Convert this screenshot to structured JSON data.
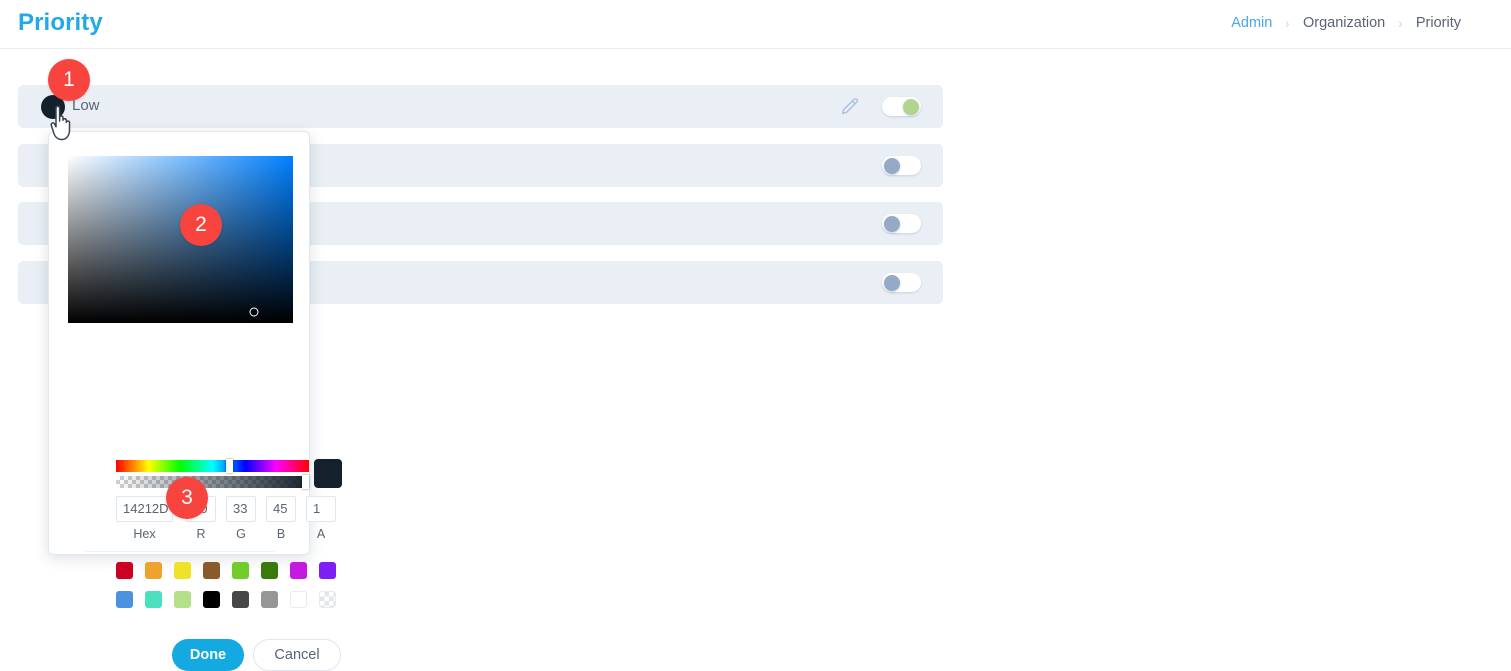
{
  "header": {
    "title": "Priority",
    "breadcrumb": [
      {
        "label": "Admin",
        "is_link": true
      },
      {
        "label": "Organization",
        "is_link": false
      },
      {
        "label": "Priority",
        "is_link": false
      }
    ],
    "separator": "›",
    "title_color": "#23a8e8"
  },
  "priority_rows": [
    {
      "label": "Low",
      "color": "#14212d",
      "toggle_state": "on",
      "has_edit_icon": true
    },
    {
      "label": "",
      "color": "",
      "toggle_state": "off",
      "has_edit_icon": false
    },
    {
      "label": "",
      "color": "",
      "toggle_state": "off",
      "has_edit_icon": false
    },
    {
      "label": "",
      "color": "",
      "toggle_state": "off",
      "has_edit_icon": false
    }
  ],
  "step_badges": [
    {
      "number": "1"
    },
    {
      "number": "2"
    },
    {
      "number": "3"
    }
  ],
  "color_picker": {
    "selected_color": "#14212d",
    "fields": {
      "hex": {
        "value": "14212D",
        "label": "Hex"
      },
      "r": {
        "value": "20",
        "label": "R"
      },
      "g": {
        "value": "33",
        "label": "G"
      },
      "b": {
        "value": "45",
        "label": "B"
      },
      "a": {
        "value": "1",
        "label": "A"
      }
    },
    "swatches_row1": [
      "#cc0022",
      "#efa32e",
      "#f0e229",
      "#8b5a2b",
      "#72cc29",
      "#3a7a0d",
      "#c41ae0",
      "#7d1ef5"
    ],
    "swatches_row2": [
      "#4b93e0",
      "#4ae0bd",
      "#b5e08a",
      "#000000",
      "#474747",
      "#969696",
      "#ffffff",
      "checker"
    ],
    "buttons": {
      "done": "Done",
      "cancel": "Cancel"
    }
  },
  "icons": {
    "edit": "pencil-icon",
    "cursor": "hand-pointer-cursor"
  }
}
